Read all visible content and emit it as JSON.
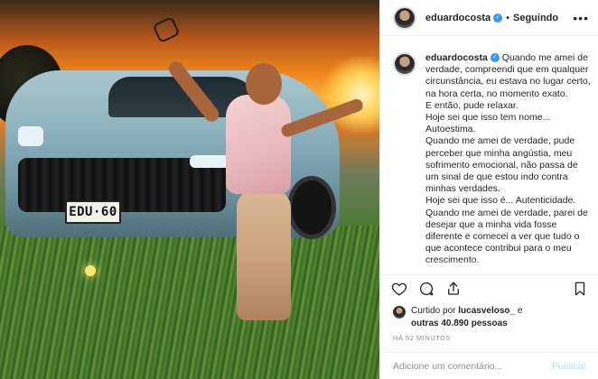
{
  "photo": {
    "plate_text": "EDU·60"
  },
  "header": {
    "username": "eduardocosta",
    "separator": "•",
    "follow_status": "Seguindo",
    "more_label": "•••"
  },
  "caption": {
    "username": "eduardocosta",
    "lines": [
      "Quando me amei de verdade, compreendi que em qualquer circunstância, eu estava no lugar certo, na hora certa, no momento exato.",
      "E então, pude relaxar.",
      "Hoje sei que isso tem nome... Autoestima.",
      "Quando me amei de verdade, pude perceber que minha angústia, meu sofrimento emocional, não passa de um sinal de que estou indo contra minhas verdades.",
      "Hoje sei que isso é... Autenticidade.",
      "Quando me amei de verdade, parei de desejar que a minha vida fosse diferente e comecei a ver que tudo o que acontece contribui para o meu crescimento."
    ]
  },
  "likes": {
    "prefix": "Curtido por",
    "user": "lucasveloso_",
    "and": "e",
    "others": "outras 40.890 pessoas"
  },
  "timestamp": "HÁ 52 MINUTOS",
  "comment_box": {
    "placeholder": "Adicione um comentário...",
    "post_label": "Publicar"
  },
  "icons": [
    "heart-icon",
    "comment-icon",
    "share-icon",
    "bookmark-icon",
    "verified-icon"
  ],
  "colors": {
    "verified": "#3897f0",
    "post_disabled": "#b2dffc",
    "muted": "#8e8e8e"
  }
}
